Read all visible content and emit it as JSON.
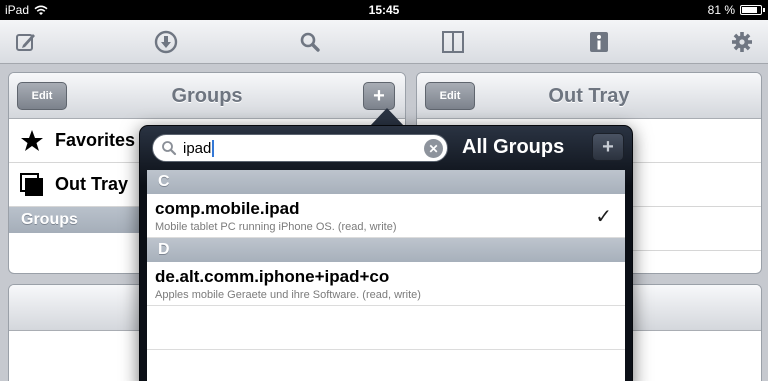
{
  "status": {
    "carrier": "iPad",
    "time": "15:45",
    "battery": "81 %",
    "battery_fraction": 0.81
  },
  "toolbar": {
    "icons": [
      "compose-icon",
      "download-icon",
      "search-icon",
      "split-view-icon",
      "info-icon",
      "gear-icon"
    ]
  },
  "left_panel": {
    "edit_label": "Edit",
    "title": "Groups",
    "plus_label": "+",
    "rows": [
      {
        "label": "Favorites",
        "icon": "star-icon"
      },
      {
        "label": "Out Tray",
        "icon": "out-tray-icon"
      }
    ],
    "section_label": "Groups"
  },
  "right_panel": {
    "edit_label": "Edit",
    "title": "Out Tray"
  },
  "popover": {
    "search_value": "ipad",
    "clear_label": "✕",
    "title": "All Groups",
    "plus_label": "+",
    "sections": [
      {
        "header": "C",
        "items": [
          {
            "title": "comp.mobile.ipad",
            "subtitle": "Mobile tablet PC running iPhone OS. (read, write)",
            "checked": true,
            "check": "✓"
          }
        ]
      },
      {
        "header": "D",
        "items": [
          {
            "title": "de.alt.comm.iphone+ipad+co",
            "subtitle": "Apples mobile Geraete und ihre Software. (read, write)",
            "checked": false
          }
        ]
      }
    ]
  }
}
